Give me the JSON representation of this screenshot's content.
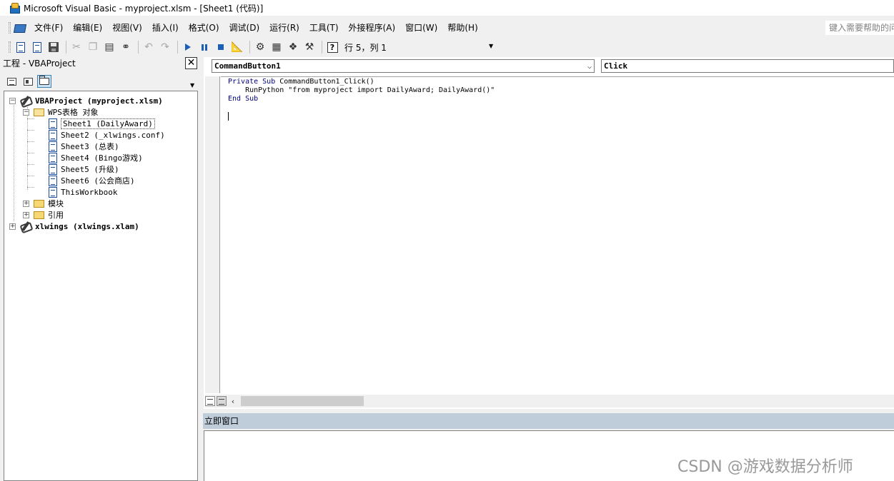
{
  "window": {
    "title": "Microsoft Visual Basic - myproject.xlsm - [Sheet1 (代码)]"
  },
  "menu": {
    "items": [
      "文件(F)",
      "编辑(E)",
      "视图(V)",
      "插入(I)",
      "格式(O)",
      "调试(D)",
      "运行(R)",
      "工具(T)",
      "外接程序(A)",
      "窗口(W)",
      "帮助(H)"
    ],
    "help_box": "键入需要帮助的问"
  },
  "toolbar": {
    "position": "行 5，列 1"
  },
  "project": {
    "title": "工程 - VBAProject",
    "close": "✕",
    "tree": {
      "root1": "VBAProject (myproject.xlsm)",
      "objects_folder": "WPS表格 对象",
      "sheet1": "Sheet1 (DailyAward)",
      "sheet2": "Sheet2 (_xlwings.conf)",
      "sheet3": "Sheet3 (总表)",
      "sheet4": "Sheet4 (Bingo游戏)",
      "sheet5": "Sheet5 (升级)",
      "sheet6": "Sheet6 (公会商店)",
      "thisworkbook": "ThisWorkbook",
      "modules": "模块",
      "references": "引用",
      "root2": "xlwings (xlwings.xlam)"
    }
  },
  "code": {
    "object": "CommandButton1",
    "procedure": "Click",
    "line1_kw": "Private Sub",
    "line1_rest": " CommandButton1_Click()",
    "line2": "    RunPython \"from myproject import DailyAward; DailyAward()\"",
    "line3": "End Sub"
  },
  "immediate": {
    "title": "立即窗口"
  },
  "watermark": "CSDN @游戏数据分析师"
}
